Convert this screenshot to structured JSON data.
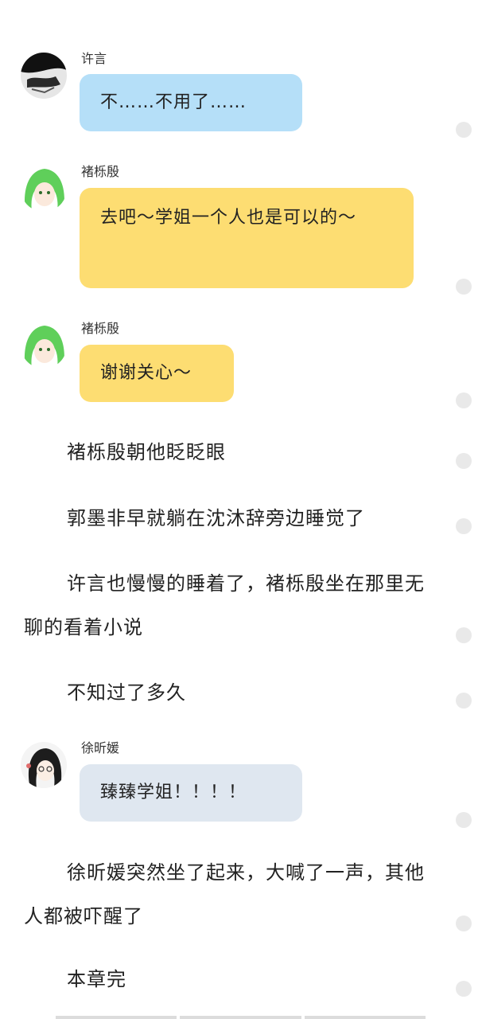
{
  "messages": [
    {
      "name": "许言",
      "text": "不……不用了……",
      "avatar_icon": "black-white-portrait"
    },
    {
      "name": "褚栎殷",
      "text": "去吧～学姐一个人也是可以的～",
      "avatar_icon": "green-hair-anime-portrait"
    },
    {
      "name": "褚栎殷",
      "text": "谢谢关心～",
      "avatar_icon": "green-hair-anime-portrait"
    },
    {
      "name": "徐昕媛",
      "text": "臻臻学姐！！！！",
      "avatar_icon": "dark-hair-glasses-portrait"
    }
  ],
  "paragraphs": [
    "褚栎殷朝他眨眨眼",
    "郭墨非早就躺在沈沐辞旁边睡觉了",
    "许言也慢慢的睡着了，褚栎殷坐在那里无聊的看着小说",
    "不知过了多久",
    "徐昕媛突然坐了起来，大喊了一声，其他人都被吓醒了",
    "本章完"
  ],
  "colors": {
    "bubble_blue": "#b5dff8",
    "bubble_yellow": "#fddd72",
    "bubble_gray": "#dfe7f0",
    "comment_dot": "#e9e9e9"
  }
}
